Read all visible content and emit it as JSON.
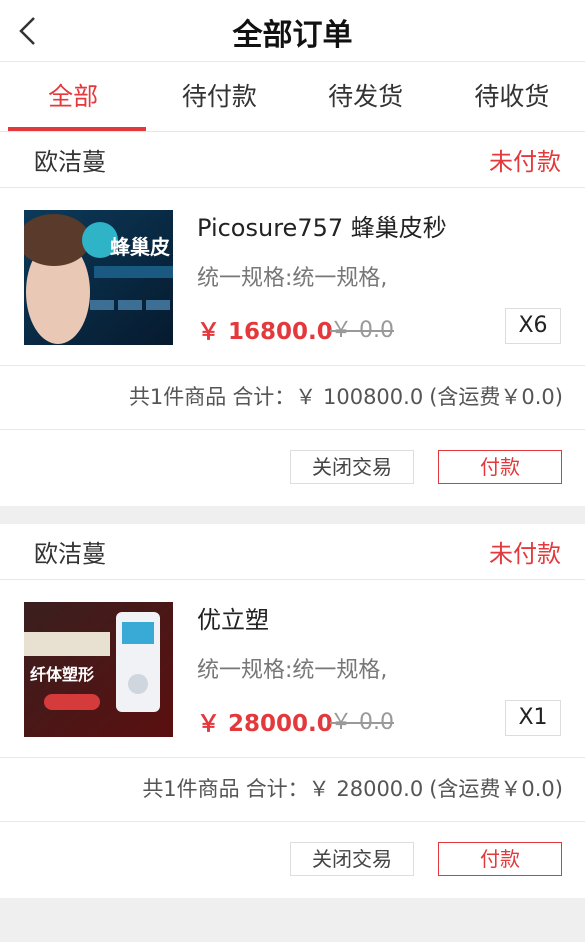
{
  "header": {
    "title": "全部订单",
    "back_icon": "chevron-left-icon"
  },
  "tabs": [
    {
      "label": "全部",
      "active": true
    },
    {
      "label": "待付款",
      "active": false
    },
    {
      "label": "待发货",
      "active": false
    },
    {
      "label": "待收货",
      "active": false
    }
  ],
  "orders": [
    {
      "shop": "欧洁蔓",
      "status": "未付款",
      "product": {
        "image_text": "蜂巢皮",
        "name": "Picosure757 蜂巢皮秒",
        "spec": "统一规格:统一规格,",
        "price": "￥ 16800.0",
        "old_price": "￥ 0.0",
        "qty": "X6"
      },
      "summary": {
        "count": "共1件商品",
        "total": "合计：￥ 100800.0",
        "shipping": "(含运费￥0.0)"
      },
      "actions": {
        "close": "关闭交易",
        "pay": "付款"
      }
    },
    {
      "shop": "欧洁蔓",
      "status": "未付款",
      "product": {
        "image_text": "纤体塑形",
        "name": "优立塑",
        "spec": "统一规格:统一规格,",
        "price": "￥ 28000.0",
        "old_price": "￥ 0.0",
        "qty": "X1"
      },
      "summary": {
        "count": "共1件商品",
        "total": "合计：￥ 28000.0",
        "shipping": "(含运费￥0.0)"
      },
      "actions": {
        "close": "关闭交易",
        "pay": "付款"
      }
    }
  ],
  "colors": {
    "accent": "#e4393c",
    "background": "#efefef"
  }
}
